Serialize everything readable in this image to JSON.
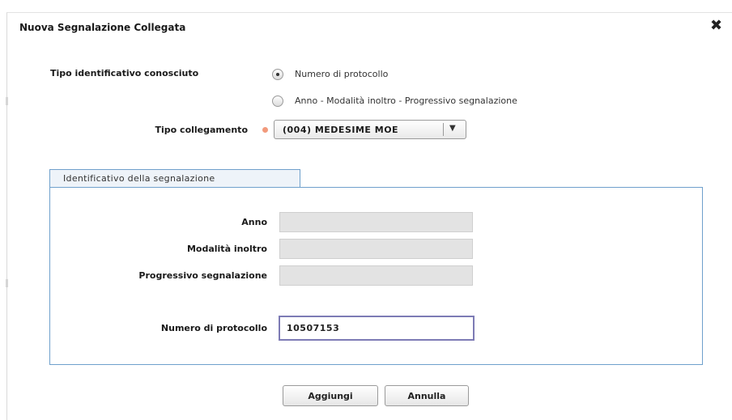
{
  "dialog": {
    "title": "Nuova Segnalazione Collegata",
    "close_glyph": "✖"
  },
  "form": {
    "tipo_identificativo_label": "Tipo identificativo conosciuto",
    "radio_options": [
      {
        "label": "Numero di protocollo",
        "checked": true
      },
      {
        "label": "Anno - Modalità inoltro - Progressivo segnalazione",
        "checked": false
      }
    ],
    "tipo_collegamento_label": "Tipo collegamento",
    "tipo_collegamento_value": "(004) MEDESIME MOE",
    "dropdown_arrow": "▼",
    "required_color": "#f29a7c"
  },
  "section": {
    "tab_label": "Identificativo della segnalazione",
    "anno_label": "Anno",
    "anno_value": "",
    "modalita_label": "Modalità inoltro",
    "modalita_value": "",
    "progressivo_label": "Progressivo segnalazione",
    "progressivo_value": "",
    "protocollo_label": "Numero di protocollo",
    "protocollo_value": "10507153",
    "border_color": "#6fa0cc"
  },
  "buttons": {
    "add_label": "Aggiungi",
    "cancel_label": "Annulla"
  },
  "icons": {
    "close": "close-icon",
    "dropdown": "chevron-down-icon",
    "required": "required-asterisk-icon"
  }
}
